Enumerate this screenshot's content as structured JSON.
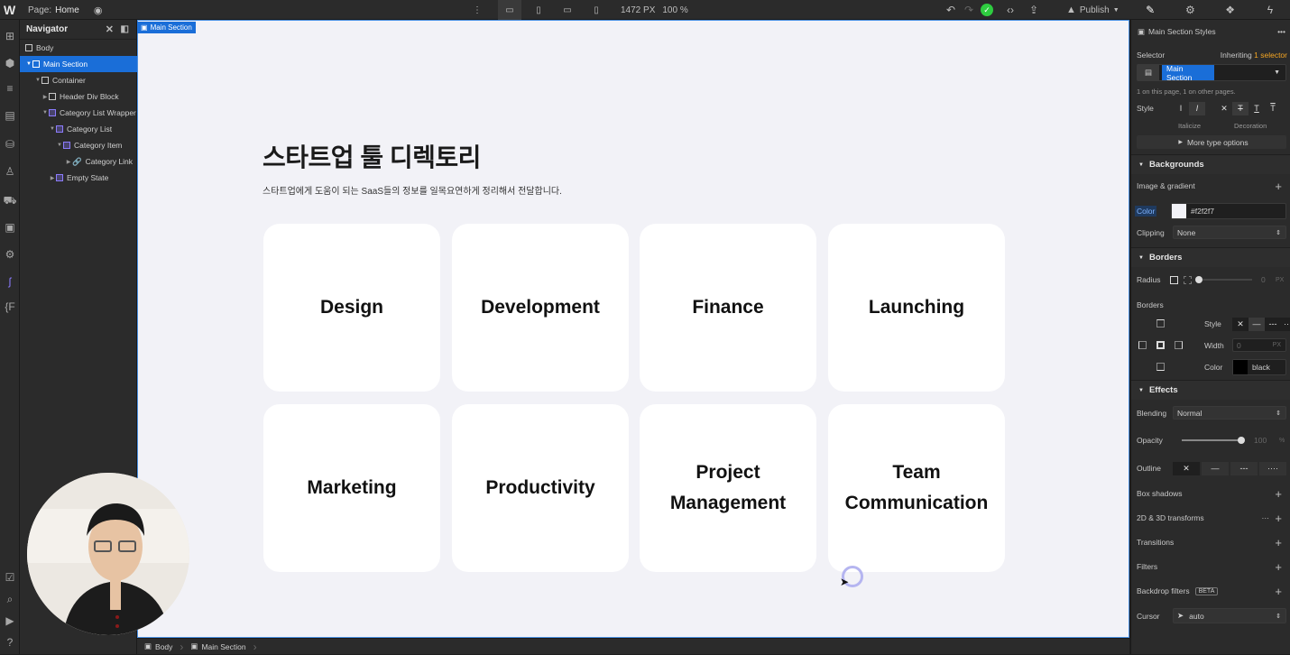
{
  "topbar": {
    "logo": "W",
    "page_label": "Page:",
    "page_name": "Home",
    "width": "1472 PX",
    "zoom": "100 %",
    "publish": "Publish"
  },
  "navigator": {
    "title": "Navigator",
    "items": [
      {
        "label": "Body"
      },
      {
        "label": "Main Section"
      },
      {
        "label": "Container"
      },
      {
        "label": "Header Div Block"
      },
      {
        "label": "Category List Wrapper"
      },
      {
        "label": "Category List"
      },
      {
        "label": "Category Item"
      },
      {
        "label": "Category Link"
      },
      {
        "label": "Empty State"
      }
    ]
  },
  "canvas": {
    "selection_tag": "Main Section",
    "heading": "스타트업 툴 디렉토리",
    "subheading": "스타트업에게 도움이 되는 SaaS들의 정보를 일목요연하게 정리해서 전달합니다.",
    "cards": [
      {
        "label": "Design"
      },
      {
        "label": "Development"
      },
      {
        "label": "Finance"
      },
      {
        "label": "Launching"
      },
      {
        "label": "Marketing"
      },
      {
        "label": "Productivity"
      },
      {
        "label": "Project Management"
      },
      {
        "label": "Team Communication"
      }
    ]
  },
  "breadcrumb": {
    "items": [
      "Body",
      "Main Section"
    ]
  },
  "style_panel": {
    "title": "Main Section Styles",
    "selector_label": "Selector",
    "inheriting": "Inheriting",
    "inheriting_count": "1 selector",
    "selector_value": "Main Section",
    "on_pages": "1 on this page, 1 on other pages.",
    "style_label": "Style",
    "italicize": "Italicize",
    "decoration": "Decoration",
    "more_type": "More type options",
    "backgrounds": "Backgrounds",
    "image_gradient": "Image & gradient",
    "color_label": "Color",
    "color_value": "#f2f2f7",
    "clipping_label": "Clipping",
    "clipping_value": "None",
    "borders_head": "Borders",
    "radius_label": "Radius",
    "radius_value": "0",
    "radius_unit": "PX",
    "borders_label": "Borders",
    "style_sub": "Style",
    "width_sub": "Width",
    "width_value": "0",
    "color_sub": "Color",
    "border_color_value": "black",
    "effects_head": "Effects",
    "blending_label": "Blending",
    "blending_value": "Normal",
    "opacity_label": "Opacity",
    "opacity_value": "100",
    "opacity_unit": "%",
    "outline_label": "Outline",
    "box_shadows": "Box shadows",
    "transforms": "2D & 3D transforms",
    "transitions": "Transitions",
    "filters": "Filters",
    "backdrop_filters": "Backdrop filters",
    "beta": "BETA",
    "cursor_label": "Cursor",
    "cursor_value": "auto"
  },
  "colors": {
    "accent": "#1a6ed8",
    "canvas_bg": "#f2f2f7",
    "success": "#2ecc40"
  }
}
